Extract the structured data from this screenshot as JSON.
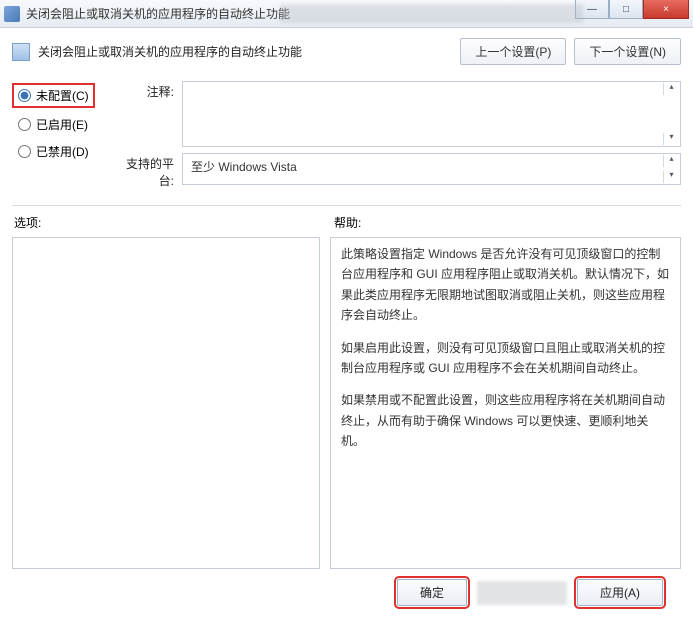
{
  "titlebar": {
    "title": "关闭会阻止或取消关机的应用程序的自动终止功能",
    "min": "—",
    "max": "□",
    "close": "×"
  },
  "header": {
    "title": "关闭会阻止或取消关机的应用程序的自动终止功能",
    "prev": "上一个设置(P)",
    "next": "下一个设置(N)"
  },
  "radios": {
    "not_configured": "未配置(C)",
    "enabled": "已启用(E)",
    "disabled": "已禁用(D)"
  },
  "fields": {
    "comment_label": "注释:",
    "platform_label": "支持的平台:",
    "platform_value": "至少 Windows Vista"
  },
  "section": {
    "options": "选项:",
    "help": "帮助:"
  },
  "help": {
    "p1": "此策略设置指定 Windows 是否允许没有可见顶级窗口的控制台应用程序和 GUI 应用程序阻止或取消关机。默认情况下，如果此类应用程序无限期地试图取消或阻止关机，则这些应用程序会自动终止。",
    "p2": "如果启用此设置，则没有可见顶级窗口且阻止或取消关机的控制台应用程序或 GUI 应用程序不会在关机期间自动终止。",
    "p3": "如果禁用或不配置此设置，则这些应用程序将在关机期间自动终止，从而有助于确保 Windows 可以更快速、更顺利地关机。"
  },
  "footer": {
    "ok": "确定",
    "apply": "应用(A)"
  }
}
